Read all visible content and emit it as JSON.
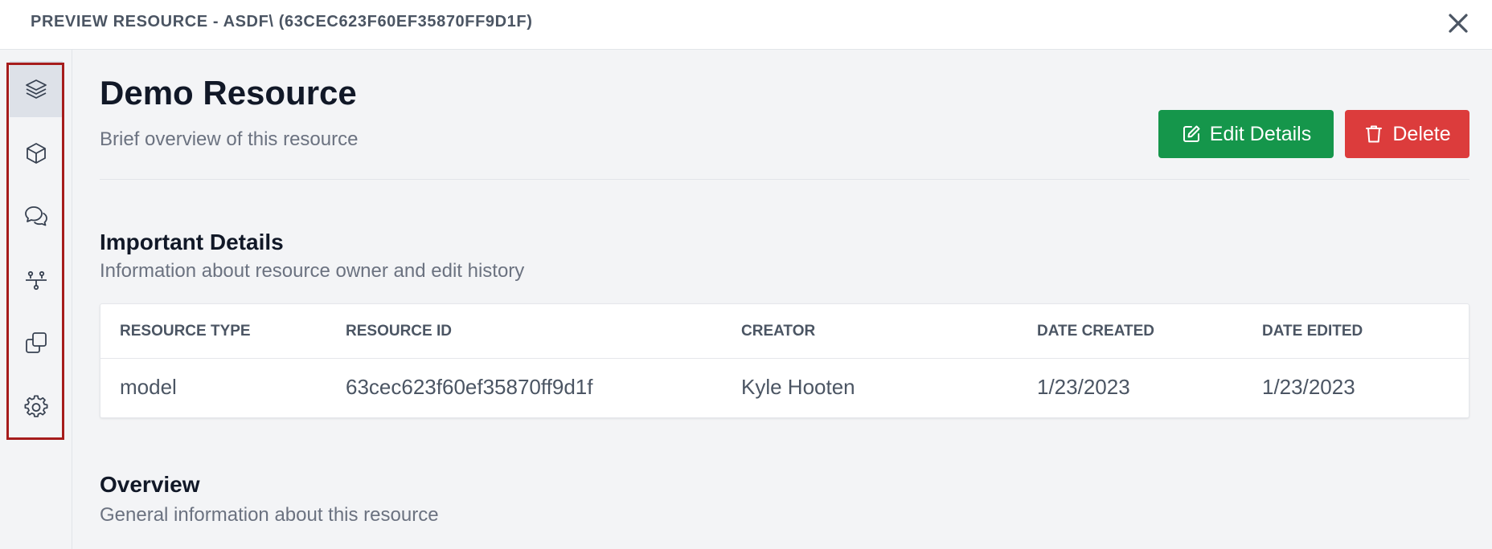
{
  "window": {
    "title": "PREVIEW RESOURCE - ASDF\\ (63CEC623F60EF35870FF9D1F)",
    "close_icon": "close-icon"
  },
  "sidebar": {
    "items": [
      {
        "name": "layers",
        "icon": "layers-icon",
        "active": true
      },
      {
        "name": "cube",
        "icon": "cube-icon",
        "active": false
      },
      {
        "name": "comments",
        "icon": "chat-bubbles-icon",
        "active": false
      },
      {
        "name": "hierarchy",
        "icon": "hierarchy-icon",
        "active": false
      },
      {
        "name": "copies",
        "icon": "copy-icon",
        "active": false
      },
      {
        "name": "settings",
        "icon": "gear-icon",
        "active": false
      }
    ],
    "highlight_color": "#a61c1c"
  },
  "header": {
    "title": "Demo Resource",
    "subtitle": "Brief overview of this resource",
    "edit_label": "Edit Details",
    "delete_label": "Delete"
  },
  "details": {
    "title": "Important Details",
    "description": "Information about resource owner and edit history",
    "columns": [
      "RESOURCE TYPE",
      "RESOURCE ID",
      "CREATOR",
      "DATE CREATED",
      "DATE EDITED"
    ],
    "rows": [
      [
        "model",
        "63cec623f60ef35870ff9d1f",
        "Kyle Hooten",
        "1/23/2023",
        "1/23/2023"
      ]
    ]
  },
  "overview": {
    "title": "Overview",
    "description": "General information about this resource"
  },
  "colors": {
    "edit": "#15964b",
    "delete": "#dc3c3c",
    "background": "#f3f4f6"
  }
}
